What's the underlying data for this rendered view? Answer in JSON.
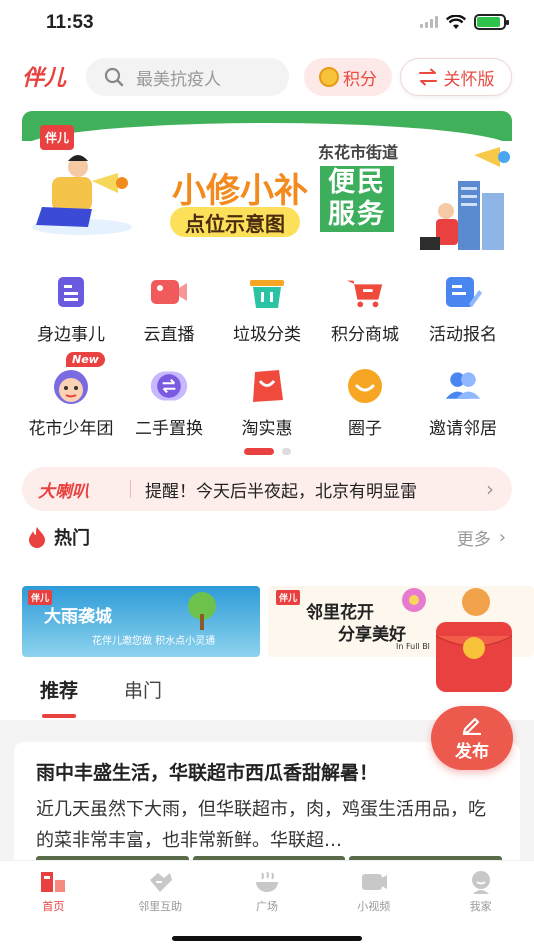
{
  "status": {
    "time": "11:53"
  },
  "header": {
    "logo": "伴儿",
    "search_placeholder": "最美抗疫人",
    "points_label": "积分",
    "care_label": "关怀版"
  },
  "banner": {
    "logo": "伴儿",
    "title": "小修小补",
    "subtitle": "点位示意图",
    "street": "东花市街道",
    "service": "便民服务"
  },
  "grid": {
    "row1": [
      {
        "label": "身边事儿",
        "icon": "document-icon",
        "color": "#6a5ae0"
      },
      {
        "label": "云直播",
        "icon": "video-icon",
        "color": "#f05a5a"
      },
      {
        "label": "垃圾分类",
        "icon": "trash-bin-icon",
        "color": "#2cc3a5"
      },
      {
        "label": "积分商城",
        "icon": "shopping-cart-icon",
        "color": "#ef4a3c"
      },
      {
        "label": "活动报名",
        "icon": "signup-form-icon",
        "color": "#4a86f0"
      }
    ],
    "row2": [
      {
        "label": "花市少年团",
        "icon": "kid-face-icon",
        "color": "#7b6be0",
        "badge": "New"
      },
      {
        "label": "二手置换",
        "icon": "exchange-icon",
        "color": "#7b5ae0"
      },
      {
        "label": "淘实惠",
        "icon": "shopping-bag-icon",
        "color": "#ef4a3c"
      },
      {
        "label": "圈子",
        "icon": "smile-bubble-icon",
        "color": "#f6a623"
      },
      {
        "label": "邀请邻居",
        "icon": "people-icon",
        "color": "#4a86f0"
      }
    ]
  },
  "notice": {
    "tag": "大喇叭",
    "text": "提醒！今天后半夜起，北京有明显雷"
  },
  "hot": {
    "title": "热门",
    "more": "更多",
    "card1": {
      "logo": "伴儿",
      "title": "大雨袭城",
      "subtitle": "花伴儿邀您做 积水点小灵通"
    },
    "card2": {
      "logo": "伴儿",
      "line1": "邻里花开",
      "line2": "分享美好",
      "line3": "In Full Bl"
    }
  },
  "tabs": [
    {
      "label": "推荐"
    },
    {
      "label": "串门"
    }
  ],
  "post": {
    "title": "雨中丰盛生活，华联超市西瓜香甜解暑！",
    "body": "近几天虽然下大雨，但华联超市，肉，鸡蛋生活用品，吃的菜非常丰富，也非常新鲜。华联超…"
  },
  "fab": {
    "label": "发布"
  },
  "tabbar": [
    {
      "label": "首页",
      "icon": "home-icon",
      "active": true
    },
    {
      "label": "邻里互助",
      "icon": "handshake-icon",
      "active": false
    },
    {
      "label": "广场",
      "icon": "square-bowl-icon",
      "active": false
    },
    {
      "label": "小视频",
      "icon": "video-play-icon",
      "active": false
    },
    {
      "label": "我家",
      "icon": "profile-icon",
      "active": false
    }
  ],
  "colors": {
    "accent": "#e8413f",
    "notice_bg": "#fdeeec"
  }
}
